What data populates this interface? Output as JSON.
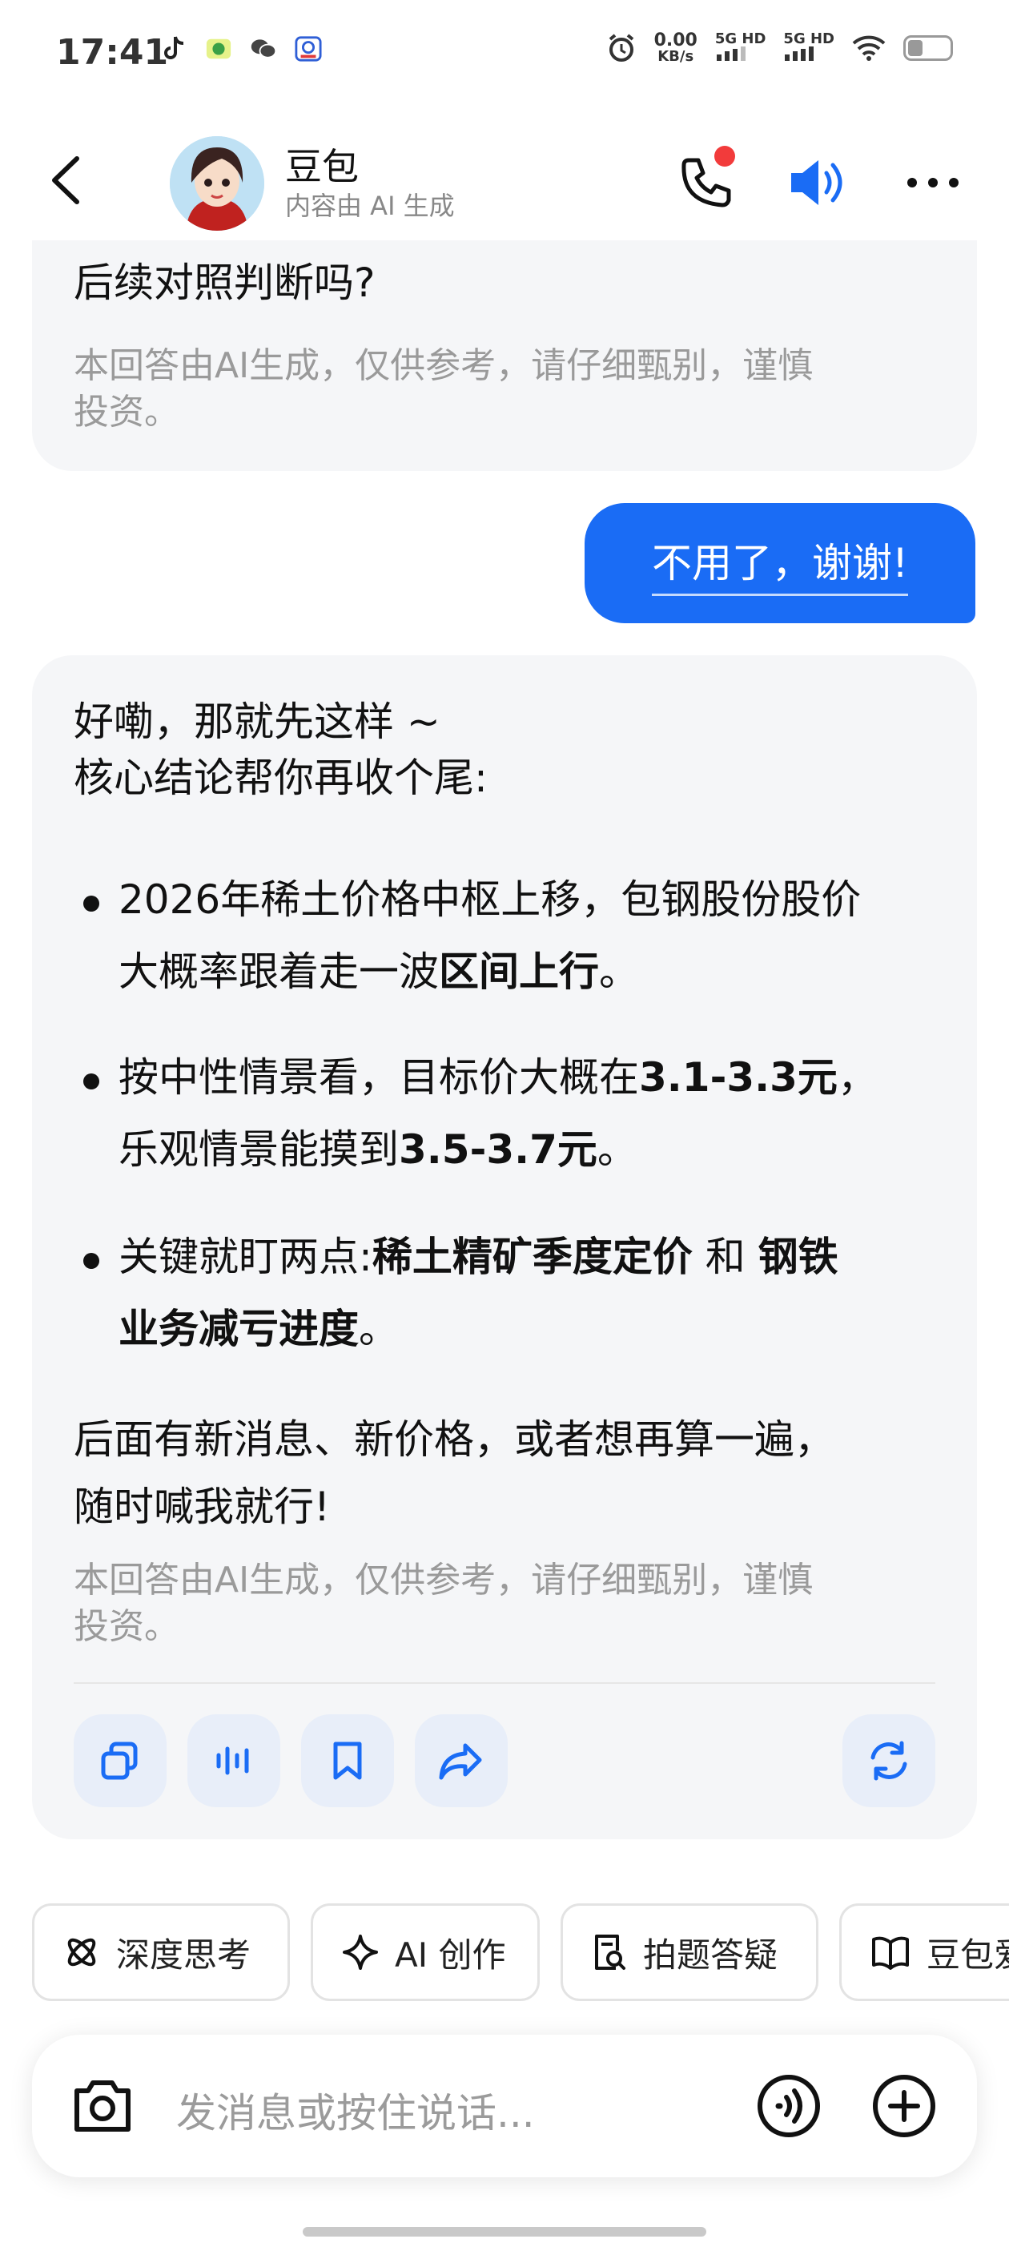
{
  "status_bar": {
    "time": "17:41",
    "speed_value": "0.00",
    "speed_unit": "KB/s",
    "sig1": "5G HD",
    "sig2": "5G HD"
  },
  "header": {
    "name": "豆包",
    "subtitle": "内容由 AI 生成"
  },
  "chat": {
    "prev_ai": {
      "tail_line": "后续对照判断吗?",
      "disclaimer_line1": "本回答由AI生成，仅供参考，请仔细甄别，谨慎",
      "disclaimer_line2": "投资。"
    },
    "user_message": "不用了，谢谢!",
    "ai_reply": {
      "line1": "好嘞，那就先这样 ~",
      "line2": "核心结论帮你再收个尾:",
      "b1_l1": "2026年稀土价格中枢上移，包钢股份股价",
      "b1_l2_plain": "大概率跟着走一波",
      "b1_l2_bold": "区间上行",
      "b1_l2_end": "。",
      "b2_l1_plain": "按中性情景看，目标价大概在",
      "b2_l1_bold": "3.1-3.3元",
      "b2_l1_end": "，",
      "b2_l2_plain": "乐观情景能摸到",
      "b2_l2_bold": "3.5-3.7元",
      "b2_l2_end": "。",
      "b3_l1_plain": "关键就盯两点:",
      "b3_l1_bold1": "稀土精矿季度定价",
      "b3_l1_mid": " 和 ",
      "b3_l1_bold2": "钢铁",
      "b3_l2_bold": "业务减亏进度",
      "b3_l2_end": "。",
      "closing1": "后面有新消息、新价格，或者想再算一遍，",
      "closing2": "随时喊我就行!",
      "disclaimer_line1": "本回答由AI生成，仅供参考，请仔细甄别，谨慎",
      "disclaimer_line2": "投资。"
    }
  },
  "actions": [
    "copy-icon",
    "voice-play-icon",
    "bookmark-icon",
    "share-icon",
    "regenerate-icon"
  ],
  "chips": [
    "深度思考",
    "AI 创作",
    "拍题答疑",
    "豆包爱"
  ],
  "input": {
    "placeholder": "发消息或按住说话..."
  },
  "colors": {
    "accent": "#1a6cf5",
    "bubble_bg": "#f5f6f8",
    "notification_dot": "#f23b3b"
  }
}
